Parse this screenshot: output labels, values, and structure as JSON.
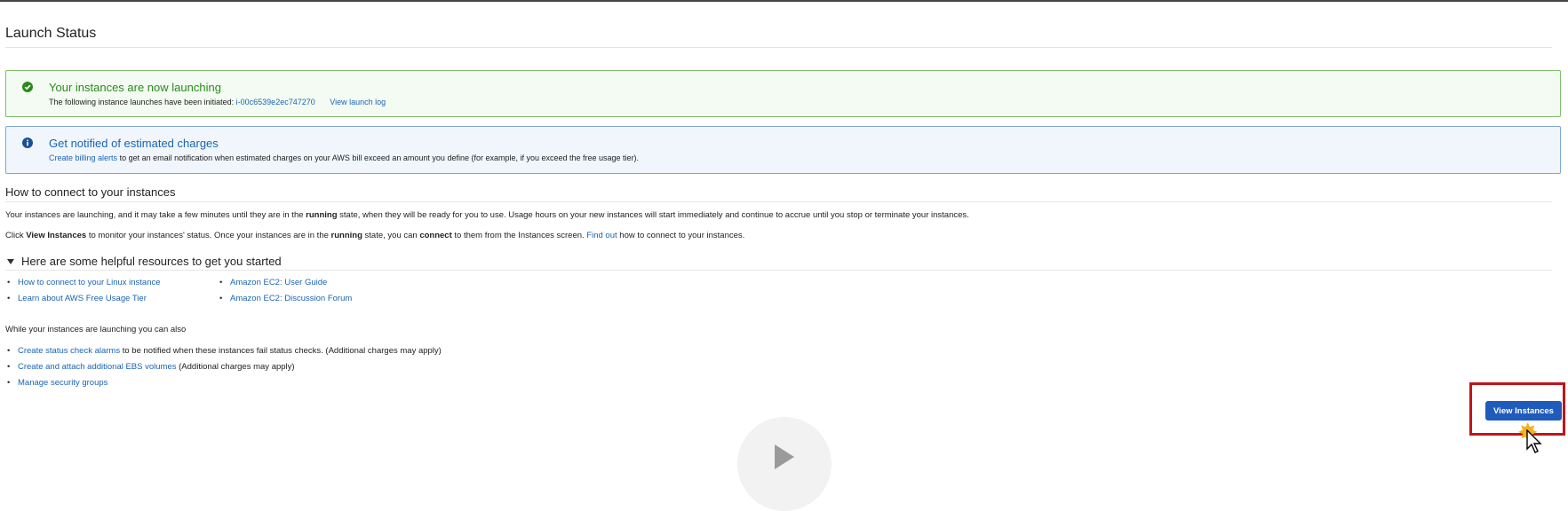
{
  "page": {
    "title": "Launch Status"
  },
  "success_alert": {
    "heading": "Your instances are now launching",
    "body_prefix": "The following instance launches have been initiated:",
    "instance_id": "i-00c6539e2ec747270",
    "view_log": "View launch log",
    "color": "#2a8a1c"
  },
  "info_alert": {
    "heading": "Get notified of estimated charges",
    "link": "Create billing alerts",
    "body": "to get an email notification when estimated charges on your AWS bill exceed an amount you define (for example, if you exceed the free usage tier).",
    "color": "#1a64b5"
  },
  "connect": {
    "heading": "How to connect to your instances",
    "p1_a": "Your instances are launching, and it may take a few minutes until they are in the",
    "p1_bold": "running",
    "p1_b": "state, when they will be ready for you to use. Usage hours on your new instances will start immediately and continue to accrue until you stop or terminate your instances.",
    "p2_a": "Click",
    "p2_bold1": "View Instances",
    "p2_b": "to monitor your instances' status. Once your instances are in the",
    "p2_bold2": "running",
    "p2_c": "state, you can",
    "p2_bold3": "connect",
    "p2_d": "to them from the Instances screen.",
    "p2_link": "Find out",
    "p2_e": "how to connect to your instances."
  },
  "resources": {
    "heading": "Here are some helpful resources to get you started",
    "col1": [
      "How to connect to your Linux instance",
      "Learn about AWS Free Usage Tier"
    ],
    "col2": [
      "Amazon EC2: User Guide",
      "Amazon EC2: Discussion Forum"
    ]
  },
  "also": {
    "heading": "While your instances are launching you can also",
    "items": [
      {
        "link": "Create status check alarms",
        "note": "to be notified when these instances fail status checks. (Additional charges may apply)"
      },
      {
        "link": "Create and attach additional EBS volumes",
        "note": "(Additional charges may apply)"
      },
      {
        "link": "Manage security groups",
        "note": ""
      }
    ]
  },
  "actions": {
    "view_instances": "View Instances",
    "accent": "#1f5bbd"
  },
  "overlays": {
    "highlight_color": "#c0141c",
    "icons": [
      "check-circle-icon",
      "info-circle-icon",
      "caret-down-icon",
      "play-icon",
      "cursor-icon"
    ]
  }
}
